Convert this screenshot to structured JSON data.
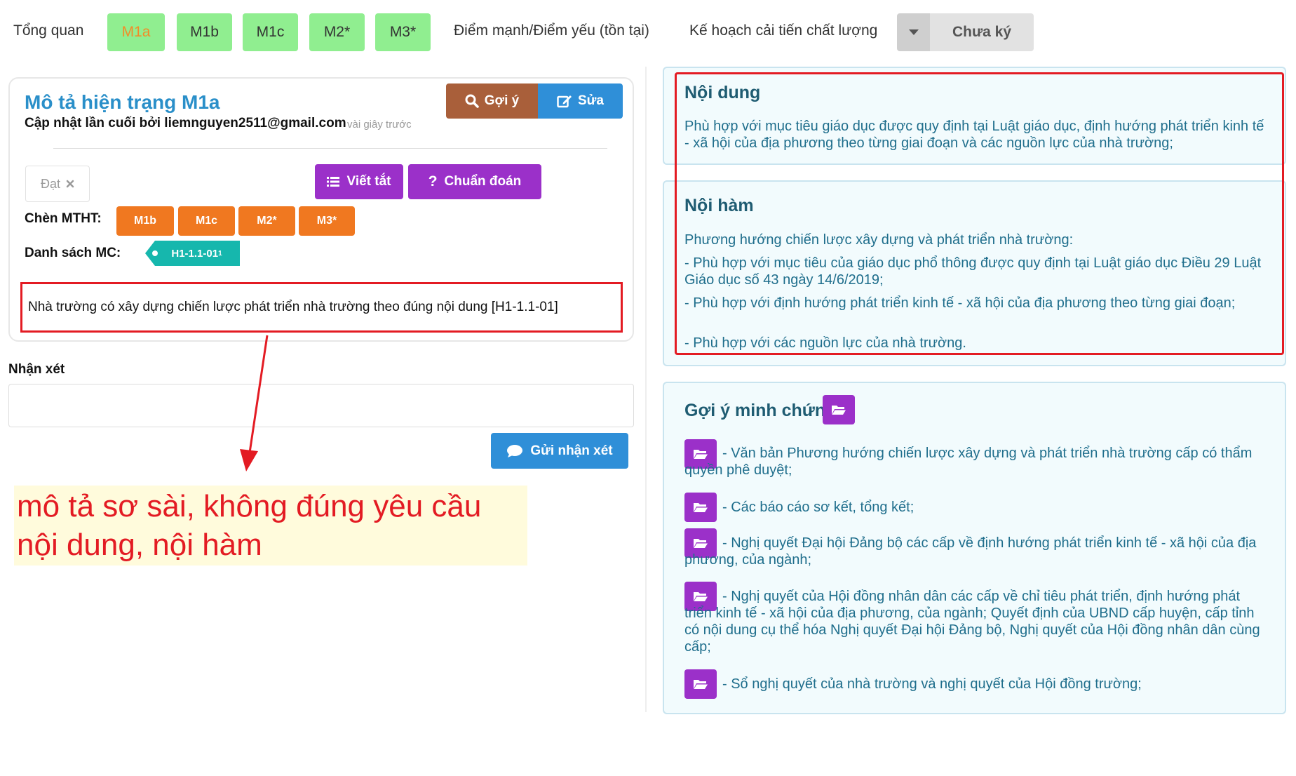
{
  "nav": {
    "overview": "Tổng quan",
    "tabs": [
      "M1a",
      "M1b",
      "M1c",
      "M2*",
      "M3*"
    ],
    "strengths": "Điểm mạnh/Điểm yếu (tồn tại)",
    "plan": "Kế hoạch cải tiến chất lượng",
    "sign_status": "Chưa ký"
  },
  "card": {
    "title": "Mô tả hiện trạng M1a",
    "updated_by": "Cập nhật lần cuối bởi liemnguyen2511@gmail.com",
    "updated_time": "vài giây trước",
    "suggest_label": "Gợi ý",
    "edit_label": "Sửa",
    "status_tag": "Đạt",
    "abbrev_label": "Viết tắt",
    "diagnose_label": "Chuẩn đoán",
    "insert_label": "Chèn MTHT:",
    "insert_tags": [
      "M1b",
      "M1c",
      "M2*",
      "M3*"
    ],
    "mc_label": "Danh sách MC:",
    "mc_tag": "H1-1.1-01",
    "mc_sub": "1",
    "description": "Nhà trường có xây dựng chiến lược phát triển nhà trường theo đúng nội dung [H1-1.1-01]"
  },
  "comment": {
    "label": "Nhận xét",
    "value": "",
    "send_label": "Gửi nhận xét"
  },
  "annotation": {
    "text": "mô tả sơ sài, không đúng yêu cầu nội dung, nội hàm"
  },
  "noi_dung": {
    "title": "Nội dung",
    "text": "Phù hợp với mục tiêu giáo dục được quy định tại Luật giáo dục, định hướng phát triển kinh tế - xã hội của địa phương theo từng giai đoạn và các nguồn lực của nhà trường;"
  },
  "noi_ham": {
    "title": "Nội hàm",
    "lines": [
      "Phương hướng chiến lược xây dựng và phát triển nhà trường:",
      "- Phù hợp với mục tiêu của giáo dục phổ thông được quy định tại Luật giáo dục Điều 29 Luật Giáo dục số 43 ngày 14/6/2019;",
      "- Phù hợp với định hướng phát triển kinh tế - xã hội của địa phương theo từng giai đoạn;",
      "- Phù hợp với các nguồn lực của nhà trường."
    ]
  },
  "evidence": {
    "title": "Gợi ý minh chứng",
    "items": [
      "- Văn bản Phương hướng chiến lược xây dựng và phát triển nhà trường cấp có thẩm quyền phê duyệt;",
      "- Các báo cáo sơ kết, tổng kết;",
      "- Nghị quyết Đại hội Đảng bộ các cấp về định hướng phát triển kinh tế - xã hội của địa phương, của ngành;",
      "- Nghị quyết của Hội đồng nhân dân các cấp về chỉ tiêu phát triển, định hướng phát triển kinh tế - xã hội của địa phương, của ngành; Quyết định của UBND cấp huyện, cấp tỉnh có nội dung cụ thể hóa Nghị quyết Đại hội Đảng bộ, Nghị quyết của Hội đồng nhân dân cùng cấp;",
      "- Sổ nghị quyết của nhà trường và nghị quyết của Hội đồng trường;"
    ]
  },
  "colors": {
    "tab_green": "#90ee90",
    "active_tab_text": "#f28c28",
    "title_blue": "#2a8fc9",
    "purple": "#9b30c9",
    "orange": "#f07820",
    "teal": "#16b7ad",
    "alert_red": "#e31b23"
  },
  "icons": {
    "suggest": "search-icon",
    "edit": "edit-icon",
    "abbrev": "list-icon",
    "diagnose": "question-icon",
    "send": "comment-icon",
    "status_remove": "close-icon",
    "caret": "caret-down-icon",
    "evidence": "folder-open-icon"
  }
}
